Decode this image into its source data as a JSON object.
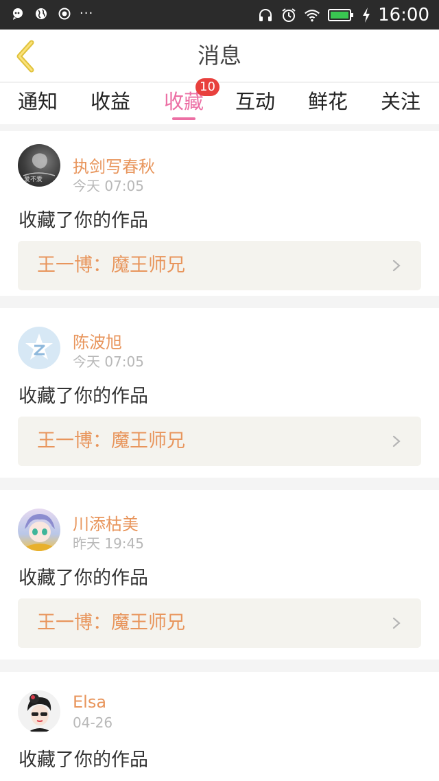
{
  "status_bar": {
    "time": "16:00",
    "dots": "···",
    "icons": [
      "notification-icon",
      "globe-icon",
      "record-icon",
      "headphones-icon",
      "alarm-icon",
      "wifi-icon",
      "battery-icon",
      "charging-icon"
    ]
  },
  "header": {
    "title": "消息",
    "back_icon": "chevron-left-icon"
  },
  "tabs": [
    {
      "label": "通知"
    },
    {
      "label": "收益"
    },
    {
      "label": "收藏",
      "badge": "10",
      "active": true
    },
    {
      "label": "互动"
    },
    {
      "label": "鲜花"
    },
    {
      "label": "关注"
    }
  ],
  "colors": {
    "accent": "#ec6fa4",
    "name": "#e8955c",
    "badge": "#e8403d"
  },
  "feed": [
    {
      "username": "执剑写春秋",
      "time": "今天 07:05",
      "action": "收藏了你的作品",
      "work": "王一博：魔王师兄",
      "avatar_text": "爱不爱"
    },
    {
      "username": "陈波旭",
      "time": "今天 07:05",
      "action": "收藏了你的作品",
      "work": "王一博：魔王师兄"
    },
    {
      "username": "川添枯美",
      "time": "昨天 19:45",
      "action": "收藏了你的作品",
      "work": "王一博：魔王师兄"
    },
    {
      "username": "Elsa",
      "time": "04-26",
      "action": "收藏了你的作品"
    }
  ]
}
